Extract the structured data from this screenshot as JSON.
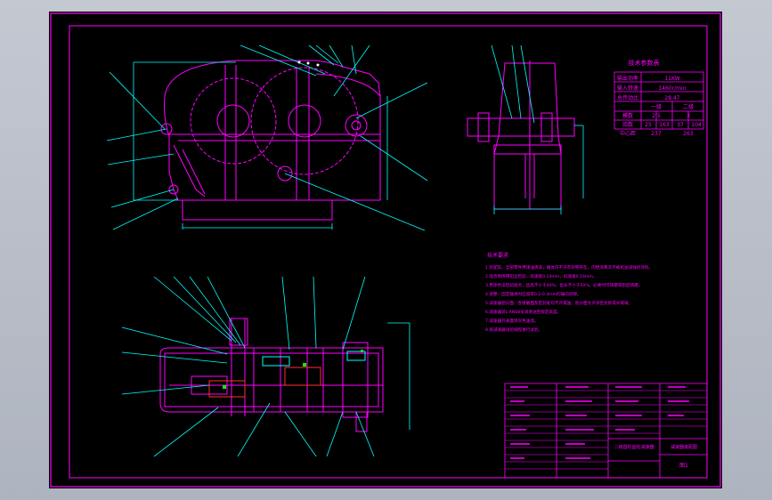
{
  "colors": {
    "background": "#b9bec8",
    "canvas": "#000000",
    "drawing": "#ff00ff",
    "leaders": "#00ffff",
    "white": "#ffffff",
    "red": "#ff3030",
    "green": "#00ff00"
  },
  "table": {
    "title": "技术参数表",
    "rows": [
      {
        "label": "输出功率",
        "value": "11KW"
      },
      {
        "label": "输入转速",
        "value": "1460r/min"
      },
      {
        "label": "总传动比",
        "value": "28.47"
      }
    ],
    "stage_header": {
      "label": "",
      "c1": "一级",
      "c2": "二级"
    },
    "gear_rows": [
      {
        "label": "模数",
        "vals": [
          "2.5",
          "3"
        ]
      },
      {
        "label": "齿数",
        "vals": [
          "25",
          "163",
          "37",
          "104"
        ]
      },
      {
        "label": "中心距",
        "vals": [
          "237",
          "263"
        ]
      }
    ]
  },
  "notes": {
    "title": "技术要求",
    "lines": [
      "1.装配前，全部零件用煤油清洗，箱体内不许有杂物存在，内壁涂两次不被机油浸蚀的涂料。",
      "2.啮合侧隙用铅丝检验，高速级0.14mm，低速级0.16mm。",
      "3.用涂色法检验斑点，齿高不小于40%，齿长不小于50%，必要时可研磨或刮后研磨。",
      "4.调整、固定轴承时应留有0.2-0.3mm的轴向间隙。",
      "5.减速器剖分面、各接触面及密封处均不许漏油，剖分面允许涂密封胶或水玻璃。",
      "6.减速器装L-AN68号润滑油至规定高度。",
      "7.减速器外表面涂灰色油漆。",
      "8.按减速器试验规程进行试验。"
    ]
  },
  "title_block": {
    "drawing_name": "二级圆柱齿轮减速器",
    "sheet": "图1",
    "school": "减速器装配图"
  }
}
